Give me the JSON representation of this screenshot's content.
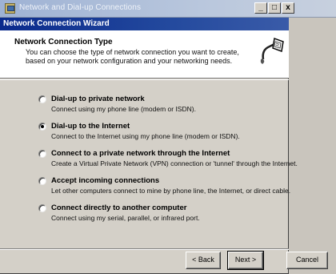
{
  "outer_window": {
    "title": "Network and Dial-up Connections",
    "controls": {
      "minimize": "_",
      "maximize": "□",
      "close": "x"
    }
  },
  "wizard": {
    "title": "Network Connection Wizard",
    "header": {
      "title": "Network Connection Type",
      "subtitle": "You can choose the type of network connection you want to create, based on your network configuration and your networking needs.",
      "icon": "network-cable-icon"
    },
    "options": [
      {
        "label": "Dial-up to private network",
        "description": "Connect using my phone line (modem or ISDN).",
        "selected": false
      },
      {
        "label": "Dial-up to the Internet",
        "description": "Connect to the Internet using my phone line (modem or ISDN).",
        "selected": true
      },
      {
        "label": "Connect to a private network through the Internet",
        "description": "Create a Virtual Private Network (VPN) connection or 'tunnel' through the Internet.",
        "selected": false
      },
      {
        "label": "Accept incoming connections",
        "description": "Let other computers connect to mine by phone line, the Internet, or direct cable.",
        "selected": false
      },
      {
        "label": "Connect directly to another computer",
        "description": "Connect using my serial, parallel, or infrared port.",
        "selected": false
      }
    ],
    "buttons": {
      "back": "< Back",
      "next": "Next >",
      "cancel": "Cancel"
    }
  }
}
